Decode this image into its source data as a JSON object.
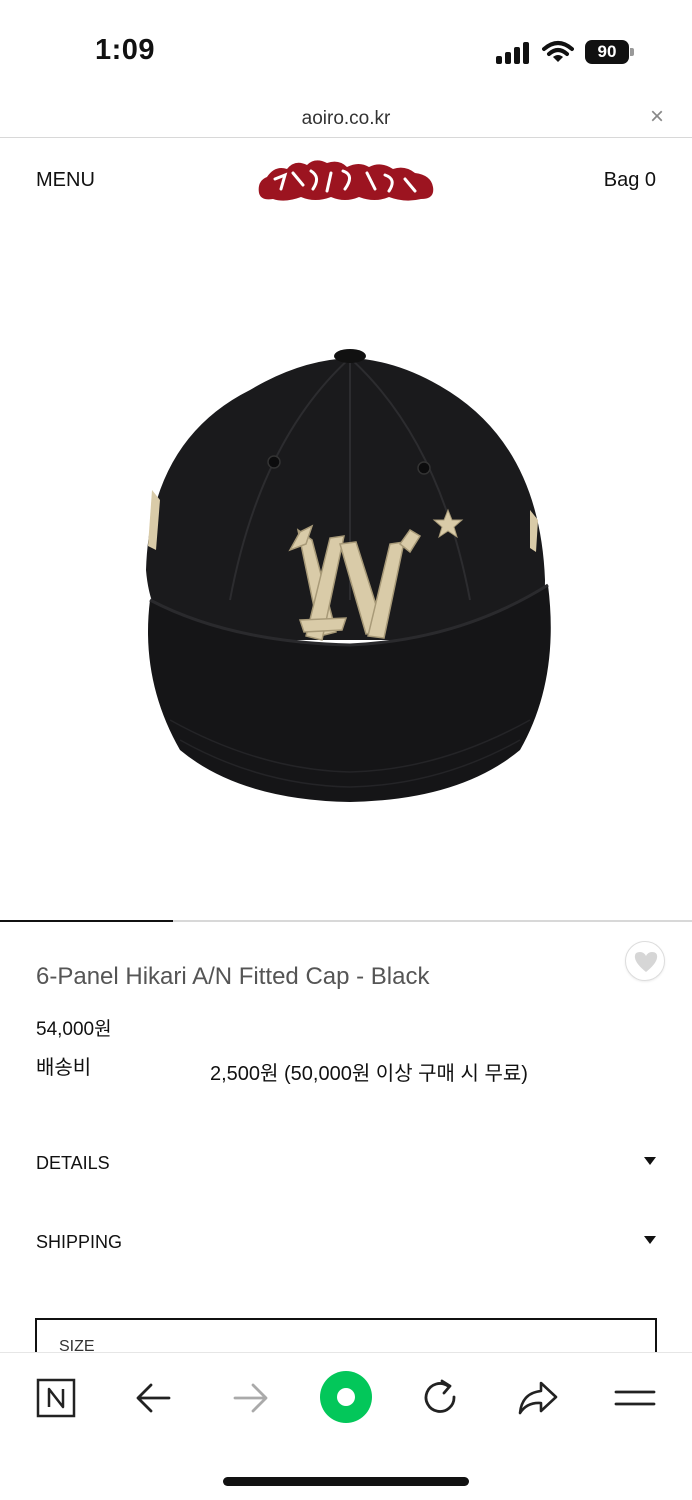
{
  "status_bar": {
    "time": "1:09",
    "battery": "90"
  },
  "browser": {
    "url": "aoiro.co.kr",
    "close_symbol": "×"
  },
  "header": {
    "menu_label": "MENU",
    "bag_label": "Bag 0",
    "logo_text": "aoiro"
  },
  "product": {
    "title": "6-Panel Hikari A/N Fitted Cap - Black",
    "price": "54,000원",
    "shipping_label": "배송비",
    "shipping_value": "2,500원 (50,000원 이상 구매 시 무료)",
    "image_alt": "black cap with embroidered A/N logo"
  },
  "accordions": {
    "details": "DETAILS",
    "shipping": "SHIPPING"
  },
  "options": {
    "size_label": "SIZE"
  },
  "carousel": {
    "progress": 0.25
  },
  "toolbar": {
    "icons": [
      "naver-n-icon",
      "back-arrow-icon",
      "forward-arrow-icon",
      "green-home-icon",
      "reload-icon",
      "share-icon",
      "menu-icon"
    ]
  },
  "colors": {
    "logo_red": "#9c1420",
    "accent_green": "#03c75a",
    "cap_black": "#1a1a1c",
    "embroidery": "#d9cba8"
  }
}
